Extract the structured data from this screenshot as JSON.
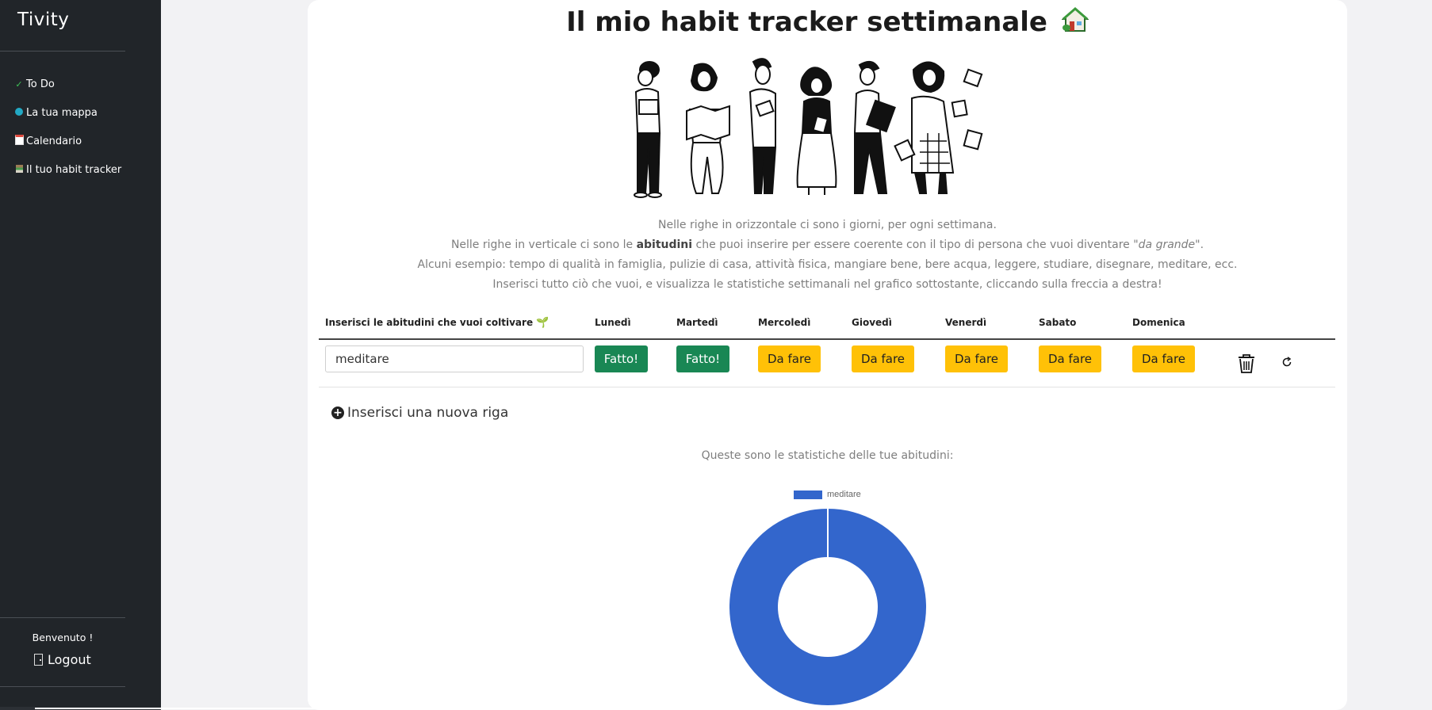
{
  "sidebar": {
    "brand": "Tivity",
    "items": [
      {
        "label": "To Do",
        "icon": "check-icon"
      },
      {
        "label": "La tua mappa",
        "icon": "globe-icon"
      },
      {
        "label": "Calendario",
        "icon": "calendar-icon"
      },
      {
        "label": "Il tuo habit tracker",
        "icon": "books-icon"
      }
    ],
    "welcome": "Benvenuto !",
    "logout": "Logout"
  },
  "main": {
    "title": "Il mio habit tracker settimanale",
    "title_icon": "house-icon",
    "intro": {
      "line1": "Nelle righe in orizzontale ci sono i giorni, per ogni settimana.",
      "line2_a": "Nelle righe in verticale ci sono le ",
      "line2_b": "abitudini",
      "line2_c": " che puoi inserire per essere coerente con il tipo di persona che vuoi diventare \"",
      "line2_d": "da grande",
      "line2_e": "\".",
      "line3": "Alcuni esempio: tempo di qualità in famiglia, pulizie di casa, attività fisica, mangiare bene, bere acqua, leggere, studiare, disegnare, meditare, ecc.",
      "line4": "Inserisci tutto ciò che vuoi, e visualizza le statistiche settimanali nel grafico sottostante, cliccando sulla freccia a destra!"
    },
    "table": {
      "habit_header": "Inserisci le abitudini che vuoi coltivare",
      "days": [
        "Lunedì",
        "Martedì",
        "Mercoledì",
        "Giovedì",
        "Venerdì",
        "Sabato",
        "Domenica"
      ],
      "rows": [
        {
          "habit": "meditare",
          "status": [
            "Fatto!",
            "Fatto!",
            "Da fare",
            "Da fare",
            "Da fare",
            "Da fare",
            "Da fare"
          ]
        }
      ]
    },
    "add_row": "Inserisci una nuova riga",
    "stats_label": "Queste sono le statistiche delle tue abitudini:"
  },
  "colors": {
    "done": "#198754",
    "todo": "#ffc107",
    "series": "#3366cc",
    "sidebar": "#212529"
  },
  "chart_data": {
    "type": "pie",
    "variant": "doughnut",
    "categories": [
      "meditare"
    ],
    "values": [
      2
    ],
    "legend": [
      "meditare"
    ],
    "legend_position": "top"
  }
}
